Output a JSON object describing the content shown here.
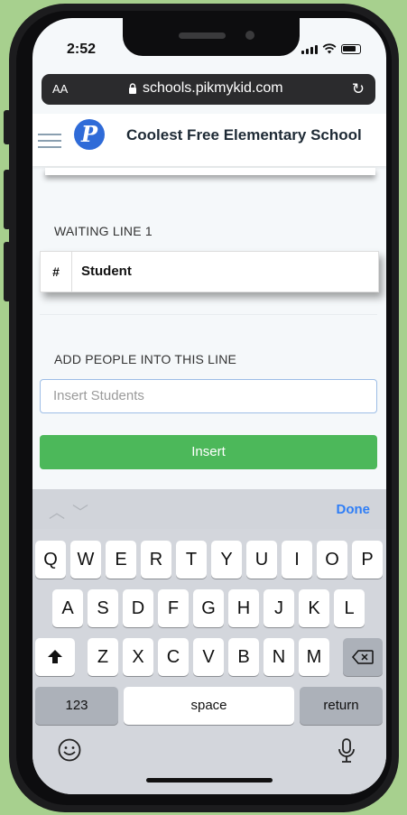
{
  "status": {
    "time": "2:52"
  },
  "browser": {
    "text_size": "AA",
    "url": "schools.pikmykid.com"
  },
  "header": {
    "logo_letter": "P",
    "school_name": "Coolest Free Elementary School"
  },
  "waiting_line": {
    "title": "WAITING LINE 1",
    "columns": [
      "#",
      "Student"
    ]
  },
  "add_people": {
    "title": "ADD PEOPLE INTO THIS LINE",
    "placeholder": "Insert Students",
    "button_label": "Insert"
  },
  "keyboard": {
    "done_label": "Done",
    "row1": [
      "Q",
      "W",
      "E",
      "R",
      "T",
      "Y",
      "U",
      "I",
      "O",
      "P"
    ],
    "row2": [
      "A",
      "S",
      "D",
      "F",
      "G",
      "H",
      "J",
      "K",
      "L"
    ],
    "row3": [
      "Z",
      "X",
      "C",
      "V",
      "B",
      "N",
      "M"
    ],
    "numbers_label": "123",
    "space_label": "space",
    "return_label": "return"
  },
  "colors": {
    "accent_green": "#4cb85a",
    "done_blue": "#2f7ef6",
    "logo_blue": "#2f6bd8"
  }
}
